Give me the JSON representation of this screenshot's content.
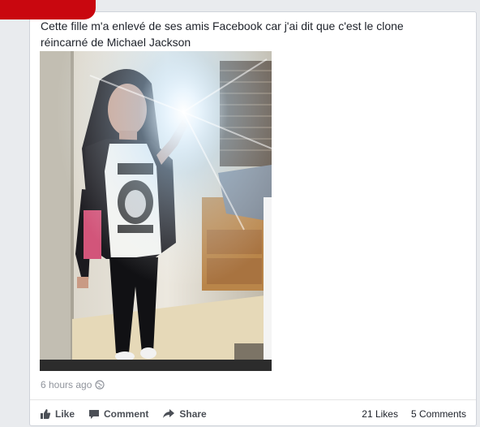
{
  "post": {
    "text_line1": "Cette fille m'a enlevé de ses amis Facebook car j'ai dit que c'est le clone",
    "text_line2": "réincarné de Michael Jackson",
    "timestamp": "6 hours ago",
    "privacy_icon": "globe-icon"
  },
  "actions": {
    "like": "Like",
    "comment": "Comment",
    "share": "Share"
  },
  "counts": {
    "likes": "21 Likes",
    "comments": "5 Comments"
  },
  "colors": {
    "accent_red": "#c9070f",
    "text": "#1d2129",
    "muted": "#90949c"
  }
}
